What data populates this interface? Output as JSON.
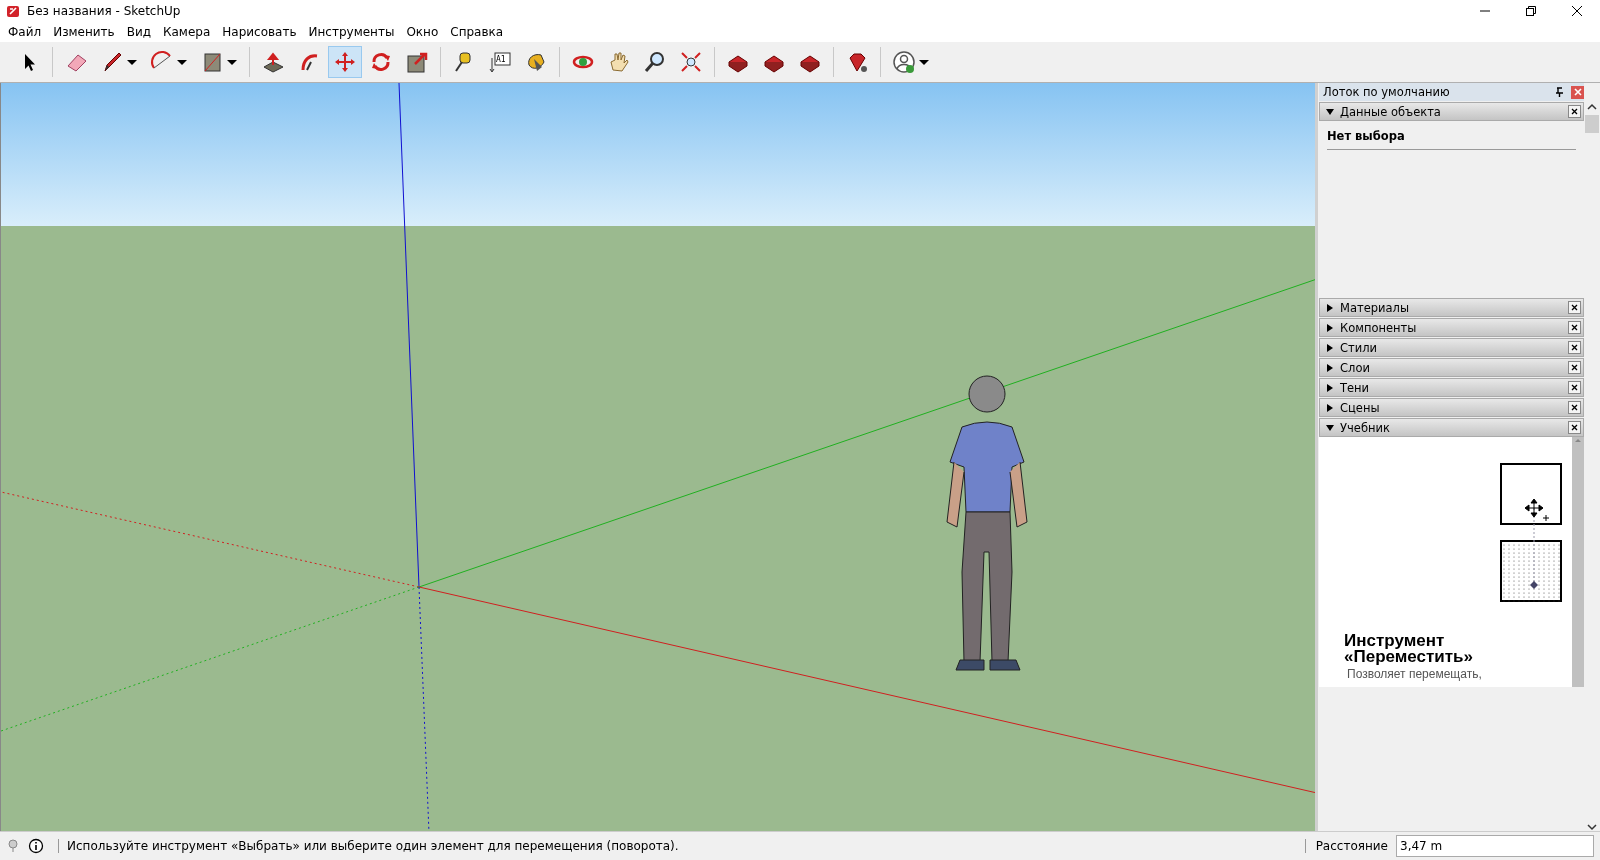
{
  "window": {
    "title": "Без названия - SketchUp"
  },
  "menu": [
    "Файл",
    "Изменить",
    "Вид",
    "Камера",
    "Нарисовать",
    "Инструменты",
    "Окно",
    "Справка"
  ],
  "toolbar": [
    {
      "kind": "select",
      "selected": false,
      "caret": false
    },
    {
      "kind": "eraser",
      "selected": false,
      "caret": false
    },
    {
      "kind": "pencil",
      "selected": false,
      "caret": true
    },
    {
      "kind": "arc",
      "selected": false,
      "caret": true
    },
    {
      "kind": "rectangle",
      "selected": false,
      "caret": true
    },
    {
      "kind": "pushpull",
      "selected": false,
      "caret": false
    },
    {
      "kind": "followme",
      "selected": false,
      "caret": false
    },
    {
      "kind": "move",
      "selected": true,
      "caret": false
    },
    {
      "kind": "rotate",
      "selected": false,
      "caret": false
    },
    {
      "kind": "scale",
      "selected": false,
      "caret": false
    },
    {
      "kind": "tape",
      "selected": false,
      "caret": false
    },
    {
      "kind": "text",
      "selected": false,
      "caret": false,
      "label": "A1"
    },
    {
      "kind": "paint",
      "selected": false,
      "caret": false
    },
    {
      "kind": "orbit",
      "selected": false,
      "caret": false
    },
    {
      "kind": "pan",
      "selected": false,
      "caret": false
    },
    {
      "kind": "zoom",
      "selected": false,
      "caret": false
    },
    {
      "kind": "extents",
      "selected": false,
      "caret": false
    },
    {
      "kind": "warehouse",
      "selected": false,
      "caret": false
    },
    {
      "kind": "warehouse",
      "selected": false,
      "caret": false
    },
    {
      "kind": "warehouse",
      "selected": false,
      "caret": false
    },
    {
      "kind": "ruby",
      "selected": false,
      "caret": false
    },
    {
      "kind": "profile",
      "selected": false,
      "caret": true
    }
  ],
  "tray": {
    "title": "Лоток по умолчанию",
    "panels": [
      {
        "label": "Данные объекта",
        "expanded": true,
        "kind": "info",
        "text": "Нет выбора"
      },
      {
        "label": "Материалы",
        "expanded": false
      },
      {
        "label": "Компоненты",
        "expanded": false
      },
      {
        "label": "Стили",
        "expanded": false
      },
      {
        "label": "Слои",
        "expanded": false
      },
      {
        "label": "Тени",
        "expanded": false
      },
      {
        "label": "Сцены",
        "expanded": false
      },
      {
        "label": "Учебник",
        "expanded": true,
        "kind": "tutorial",
        "heading": "Инструмент «Переместить»",
        "text": "Позволяет перемещать,"
      }
    ]
  },
  "status_bar": {
    "message": "Используйте инструмент «Выбрать» или выберите один элемент для перемещения (поворота).",
    "measure_label": "Расстояние",
    "measure_value": "3,47 m"
  }
}
